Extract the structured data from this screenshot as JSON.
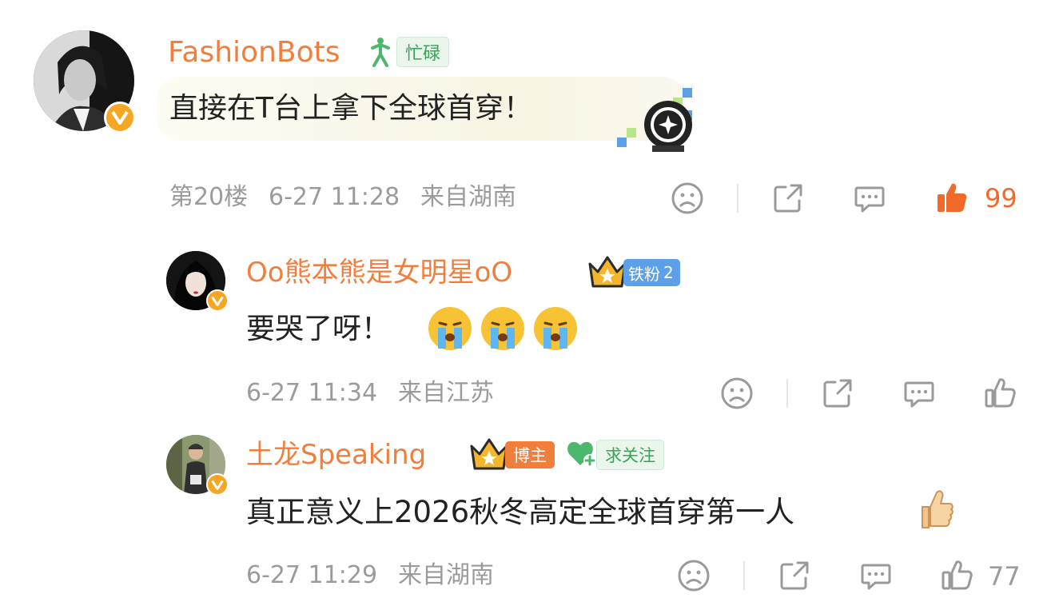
{
  "comments": [
    {
      "username": "FashionBots",
      "badge_label": "忙碌",
      "text": "直接在T台上拿下全球首穿！",
      "floor": "第20楼",
      "time": "6-27 11:28",
      "location": "来自湖南",
      "likes": "99",
      "liked": true
    },
    {
      "username": "Oo熊本熊是女明星oO",
      "crown_level": "II",
      "fan_label": "铁粉",
      "fan_level": "2",
      "text": "要哭了呀！",
      "emojis": [
        "crying-face",
        "crying-face",
        "crying-face"
      ],
      "time": "6-27 11:34",
      "location": "来自江苏",
      "likes": "",
      "liked": false
    },
    {
      "username": "土龙Speaking",
      "crown_level": "II",
      "blogger_label": "博主",
      "follow_label": "求关注",
      "text": "真正意义上2026秋冬高定全球首穿第一人",
      "emoji": "thumbs-up",
      "time": "6-27 11:29",
      "location": "来自湖南",
      "likes": "77",
      "liked": false
    }
  ],
  "colors": {
    "username": "#f07e3d",
    "meta": "#9b9b9b",
    "icon": "#9a9a9a",
    "liked": "#f26a2a",
    "verified": "#f5a623",
    "fan_badge": "#5ea0e8",
    "blogger_badge": "#f07e3d",
    "follow_badge": "#4cb86d"
  },
  "icons": [
    "verified-icon",
    "dislike-icon",
    "share-icon",
    "comment-icon",
    "like-icon",
    "crown-icon",
    "heart-plus-icon",
    "runner-icon"
  ]
}
